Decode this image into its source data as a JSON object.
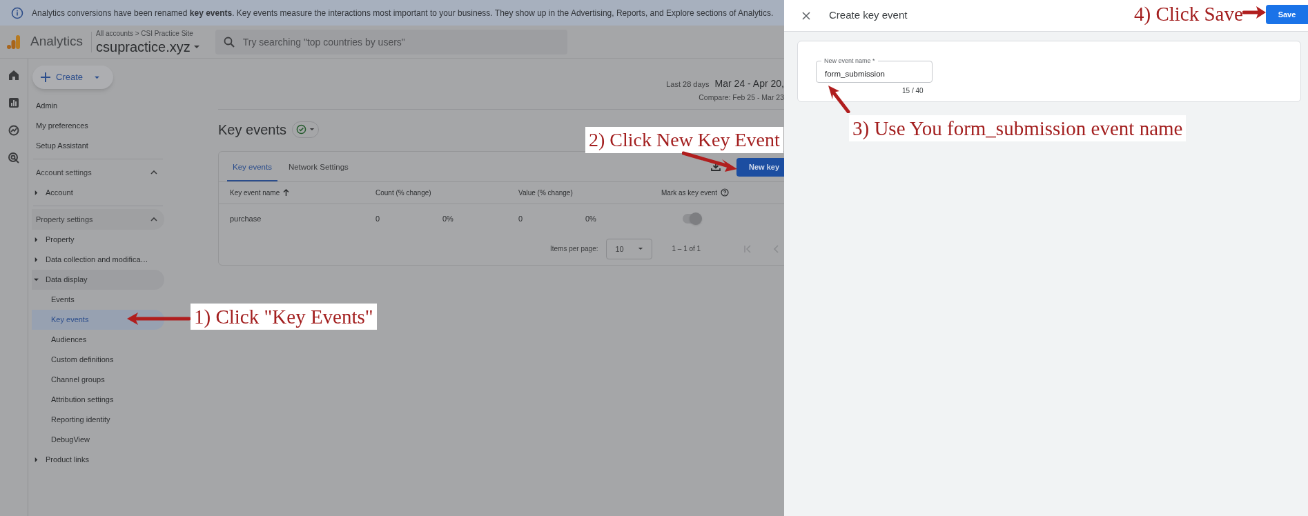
{
  "banner": {
    "text": "Analytics conversions have been renamed **key events**. Key events measure the interactions most important to your business. They show up in the Advertising, Reports, and Explore sections of Analytics."
  },
  "header": {
    "product": "Analytics",
    "breadcrumb": "All accounts > CSI Practice Site",
    "property": "csupractice.xyz",
    "search": {
      "placeholder": "Try searching \"top countries by users\""
    }
  },
  "create_button": "Create",
  "sidebar": {
    "items": [
      {
        "kind": "link",
        "label": "Admin"
      },
      {
        "kind": "link",
        "label": "My preferences"
      },
      {
        "kind": "link",
        "label": "Setup Assistant"
      },
      {
        "kind": "section",
        "label": "Account settings",
        "expanded": true,
        "children": [
          {
            "label": "Account",
            "expanded": false
          }
        ]
      },
      {
        "kind": "section",
        "label": "Property settings",
        "expanded": true,
        "children": [
          {
            "label": "Property",
            "expanded": false
          },
          {
            "label": "Data collection and modifica…",
            "expanded": false
          },
          {
            "label": "Data display",
            "expanded": true,
            "children": [
              {
                "label": "Events",
                "selected": false
              },
              {
                "label": "Key events",
                "selected": true
              },
              {
                "label": "Audiences",
                "selected": false
              },
              {
                "label": "Custom definitions",
                "selected": false
              },
              {
                "label": "Channel groups",
                "selected": false
              },
              {
                "label": "Attribution settings",
                "selected": false
              },
              {
                "label": "Reporting identity",
                "selected": false
              },
              {
                "label": "DebugView",
                "selected": false
              }
            ]
          },
          {
            "label": "Product links",
            "expanded": false
          }
        ]
      }
    ]
  },
  "date_range": {
    "preset": "Last 28 days",
    "range": "Mar 24 - Apr 20,",
    "compare": "Compare: Feb 25 - Mar 23"
  },
  "page_title": "Key events",
  "tabs": [
    {
      "label": "Key events",
      "selected": true
    },
    {
      "label": "Network Settings",
      "selected": false
    }
  ],
  "new_button": "New key",
  "table": {
    "columns": [
      {
        "label": "Key event name",
        "sorted": true
      },
      {
        "label": "Count (% change)",
        "sorted": false
      },
      {
        "label": "Value (% change)",
        "sorted": false
      },
      {
        "label": "Mark as key event",
        "sorted": false
      }
    ],
    "rows": [
      {
        "name": "purchase",
        "count": "0",
        "count_change": "0%",
        "value": "0",
        "value_change": "0%",
        "key_event": true
      }
    ]
  },
  "pagination": {
    "label": "Items per page:",
    "items_per_page": "10",
    "range": "1 – 1 of 1"
  },
  "panel": {
    "title": "Create key event",
    "save": "Save",
    "field": {
      "label": "New event name *",
      "value": "form_submission",
      "counter": "15 / 40"
    }
  },
  "annotations": [
    {
      "text": "1) Click \"Key Events\""
    },
    {
      "text": "2) Click New Key Event"
    },
    {
      "text": "3) Use You form_submission event name"
    },
    {
      "text": "4) Click Save"
    }
  ]
}
